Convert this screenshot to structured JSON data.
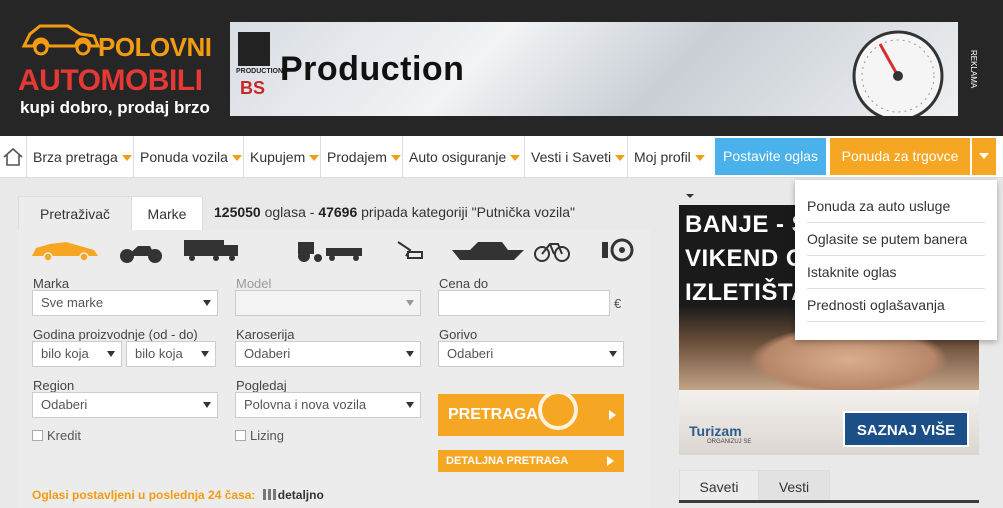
{
  "header": {
    "logo": {
      "line1": "POLOVNI",
      "line2": "AUTOMOBILI",
      "tagline": "kupi dobro, prodaj brzo"
    },
    "banner": {
      "title": "Production",
      "badge": "BS",
      "badge_small": "PRODUCTION"
    },
    "reklama": "REKLAMA"
  },
  "nav": {
    "home_icon": "home-icon",
    "items": [
      {
        "label": "Brza pretraga"
      },
      {
        "label": "Ponuda vozila"
      },
      {
        "label": "Kupujem"
      },
      {
        "label": "Prodajem"
      },
      {
        "label": "Auto osiguranje"
      },
      {
        "label": "Vesti i Saveti"
      },
      {
        "label": "Moj profil"
      }
    ],
    "post_ad": "Postavite oglas",
    "dealers": "Ponuda za trgovce"
  },
  "dropdown": {
    "items": [
      {
        "label": "Ponuda za auto usluge"
      },
      {
        "label": "Oglasite se putem banera"
      },
      {
        "label": "Istaknite oglas"
      },
      {
        "label": "Prednosti oglašavanja"
      }
    ]
  },
  "search": {
    "tabs": [
      {
        "label": "Pretraživač"
      },
      {
        "label": "Marke"
      }
    ],
    "summary": {
      "count": "125050",
      "text1": " oglasa - ",
      "category_count": "47696",
      "text2": " pripada kategoriji \"Putnička vozila\""
    },
    "categories": [
      "car-icon",
      "motorcycle-icon",
      "truck-icon",
      "tractor-icon",
      "excavator-icon",
      "boat-icon",
      "bicycle-icon",
      "parts-icon"
    ],
    "fields": {
      "marka": {
        "label": "Marka",
        "value": "Sve marke"
      },
      "model": {
        "label": "Model",
        "value": ""
      },
      "cena": {
        "label": "Cena do",
        "value": "",
        "unit": "€"
      },
      "godina": {
        "label": "Godina proizvodnje (od - do)",
        "from": "bilo koja",
        "to": "bilo koja"
      },
      "karoserija": {
        "label": "Karoserija",
        "value": "Odaberi"
      },
      "gorivo": {
        "label": "Gorivo",
        "value": "Odaberi"
      },
      "region": {
        "label": "Region",
        "value": "Odaberi"
      },
      "pogledaj": {
        "label": "Pogledaj",
        "value": "Polovna i nova vozila"
      },
      "kredit": {
        "label": "Kredit",
        "checked": false
      },
      "lizing": {
        "label": "Lizing",
        "checked": false
      }
    },
    "search_button": "PRETRAGA",
    "detail_button": "DETALJNA PRETRAGA",
    "recent": {
      "label": "Oglasi postavljeni u poslednja 24 časa:",
      "link": "detaljno"
    }
  },
  "side_ad": {
    "lines": [
      "BANJE - SP",
      "VIKEND O",
      "IZLETIŠTA"
    ],
    "logo": "Turizam",
    "logo_small": "ORGANIZUJ SE",
    "cta": "SAZNAJ VIŠE"
  },
  "side_tabs": [
    {
      "label": "Saveti"
    },
    {
      "label": "Vesti"
    }
  ],
  "colors": {
    "orange": "#f5a623",
    "blue": "#4ab1ea",
    "red": "#e53935",
    "dark": "#262626"
  }
}
